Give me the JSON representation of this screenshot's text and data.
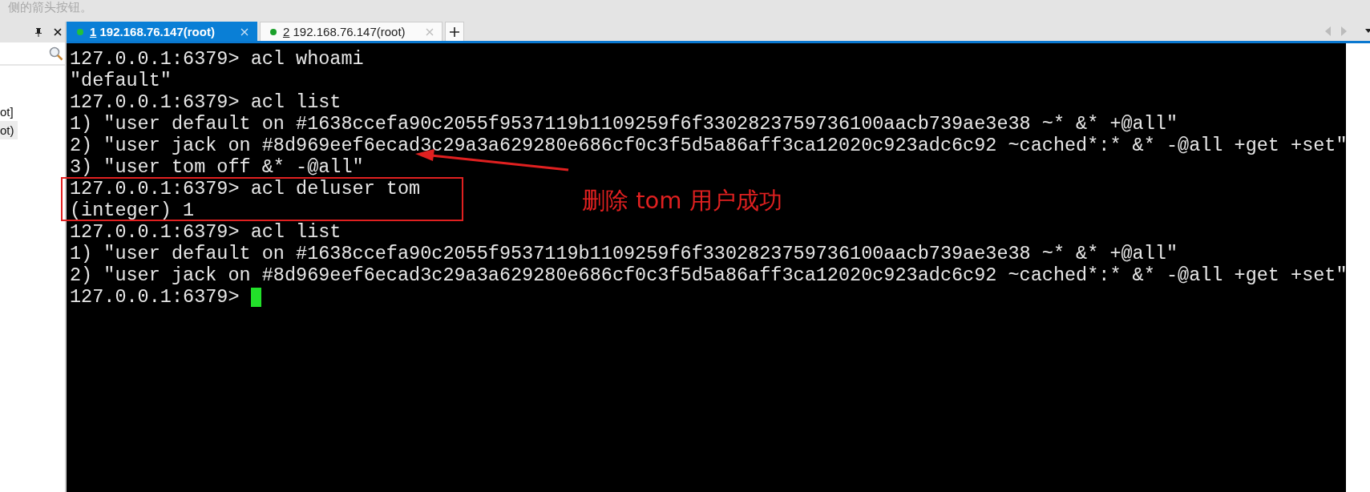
{
  "top_hint": "侧的箭头按钮。",
  "side_panel": {
    "items": [
      {
        "label": "ot]",
        "selected": false
      },
      {
        "label": "ot)",
        "selected": true
      }
    ]
  },
  "tabs": [
    {
      "number": "1",
      "title": "192.168.76.147(root)",
      "selected": true
    },
    {
      "number": "2",
      "title": "192.168.76.147(root)",
      "selected": false
    }
  ],
  "terminal": {
    "lines": [
      {
        "text": "127.0.0.1:6379> acl whoami"
      },
      {
        "text": "\"default\""
      },
      {
        "text": "127.0.0.1:6379> acl list"
      },
      {
        "text": "1) \"user default on #1638ccefa90c2055f9537119b1109259f6f3302823759736100aacb739ae3e38 ~* &* +@all\""
      },
      {
        "text": "2) \"user jack on #8d969eef6ecad3c29a3a629280e686cf0c3f5d5a86aff3ca12020c923adc6c92 ~cached*:* &* -@all +get +set\""
      },
      {
        "text": "3) \"user tom off &* -@all\""
      },
      {
        "text": "127.0.0.1:6379> acl deluser tom"
      },
      {
        "text": "(integer) 1"
      },
      {
        "text": "127.0.0.1:6379> acl list"
      },
      {
        "text": "1) \"user default on #1638ccefa90c2055f9537119b1109259f6f3302823759736100aacb739ae3e38 ~* &* +@all\""
      },
      {
        "text": "2) \"user jack on #8d969eef6ecad3c29a3a629280e686cf0c3f5d5a86aff3ca12020c923adc6c92 ~cached*:* &* -@all +get +set\""
      },
      {
        "text": "127.0.0.1:6379> ",
        "cursor": true
      }
    ]
  },
  "annotation": {
    "text": "删除 tom 用户成功"
  }
}
